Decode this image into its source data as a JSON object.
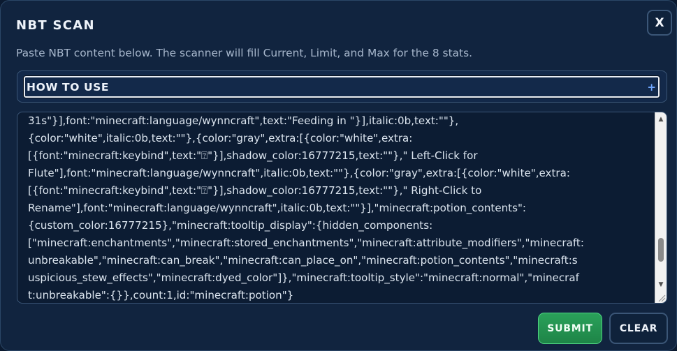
{
  "modal": {
    "title": "NBT SCAN",
    "close_label": "X",
    "subtitle": "Paste NBT content below. The scanner will fill Current, Limit, and Max for the 8 stats."
  },
  "howto": {
    "label": "HOW TO USE",
    "toggle_icon": "+"
  },
  "nbt_input": {
    "lines": [
      "31s\"}],font:\"minecraft:language/wynncraft\",text:\"Feeding in \"}],italic:0b,text:\"\"},",
      "{color:\"white\",italic:0b,text:\"\"},{color:\"gray\",extra:[{color:\"white\",extra:",
      "[{font:\"minecraft:keybind\",text:\"⍰\"}],shadow_color:16777215,text:\"\"},\" Left-Click for",
      "Flute\"],font:\"minecraft:language/wynncraft\",italic:0b,text:\"\"},{color:\"gray\",extra:[{color:\"white\",extra:",
      "[{font:\"minecraft:keybind\",text:\"⍰\"}],shadow_color:16777215,text:\"\"},\" Right-Click to",
      "Rename\"],font:\"minecraft:language/wynncraft\",italic:0b,text:\"\"}],\"minecraft:potion_contents\":",
      "{custom_color:16777215},\"minecraft:tooltip_display\":{hidden_components:",
      "[\"minecraft:enchantments\",\"minecraft:stored_enchantments\",\"minecraft:attribute_modifiers\",\"minecraft:",
      "unbreakable\",\"minecraft:can_break\",\"minecraft:can_place_on\",\"minecraft:potion_contents\",\"minecraft:s",
      "uspicious_stew_effects\",\"minecraft:dyed_color\"]},\"minecraft:tooltip_style\":\"minecraft:normal\",\"minecraf",
      "t:unbreakable\":{}},count:1,id:\"minecraft:potion\"}"
    ],
    "scroll_progress": 0.88
  },
  "actions": {
    "submit_label": "SUBMIT",
    "clear_label": "CLEAR"
  },
  "colors": {
    "modal_bg": "#11243f",
    "accent_green": "#2aa15a",
    "accent_blue": "#6fa6ff",
    "border": "#3b5677"
  },
  "icons": {
    "close": "close-icon",
    "expand": "plus-icon",
    "scroll_up": "chevron-up-icon",
    "scroll_down": "chevron-down-icon",
    "resize": "resize-grip-icon"
  }
}
